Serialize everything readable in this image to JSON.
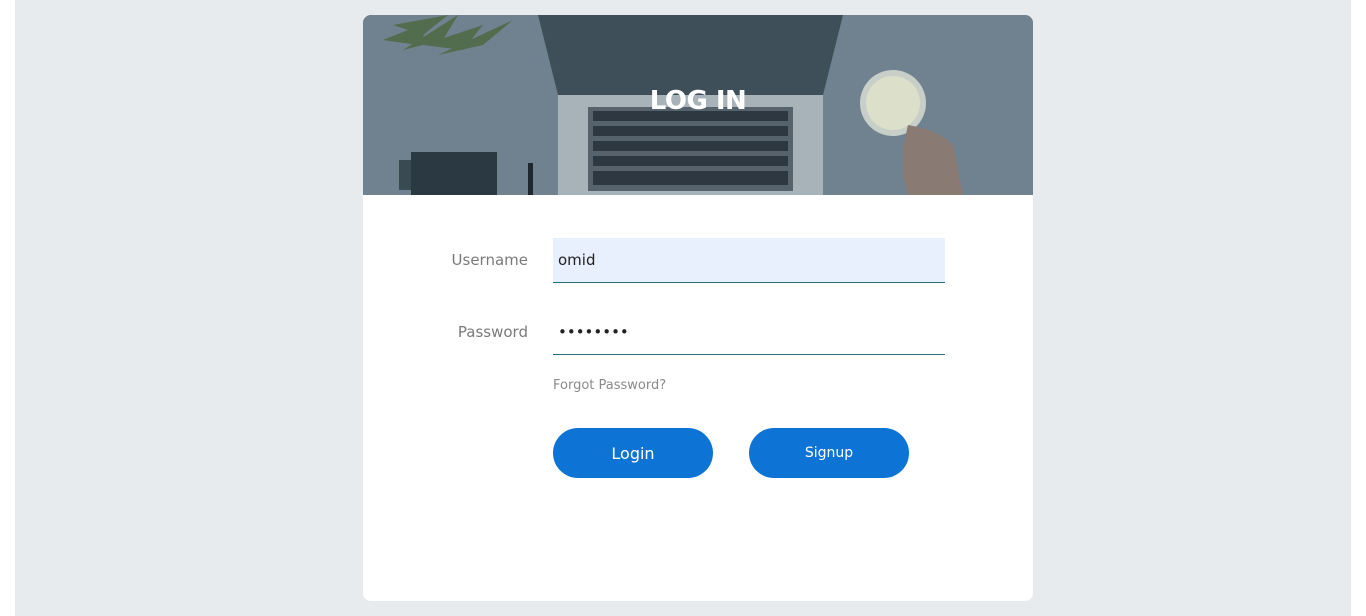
{
  "header": {
    "title": "LOG IN"
  },
  "form": {
    "username_label": "Username",
    "username_value": "omid",
    "password_label": "Password",
    "password_value": "omidpass",
    "forgot_link": "Forgot Password?"
  },
  "buttons": {
    "login_label": "Login",
    "signup_label": "Signup"
  },
  "colors": {
    "page_background": "#e8ebed",
    "card_background": "#ffffff",
    "accent_button": "#0d74d6",
    "input_underline": "#2a6f80",
    "autofill_background": "#e8f0fd"
  }
}
